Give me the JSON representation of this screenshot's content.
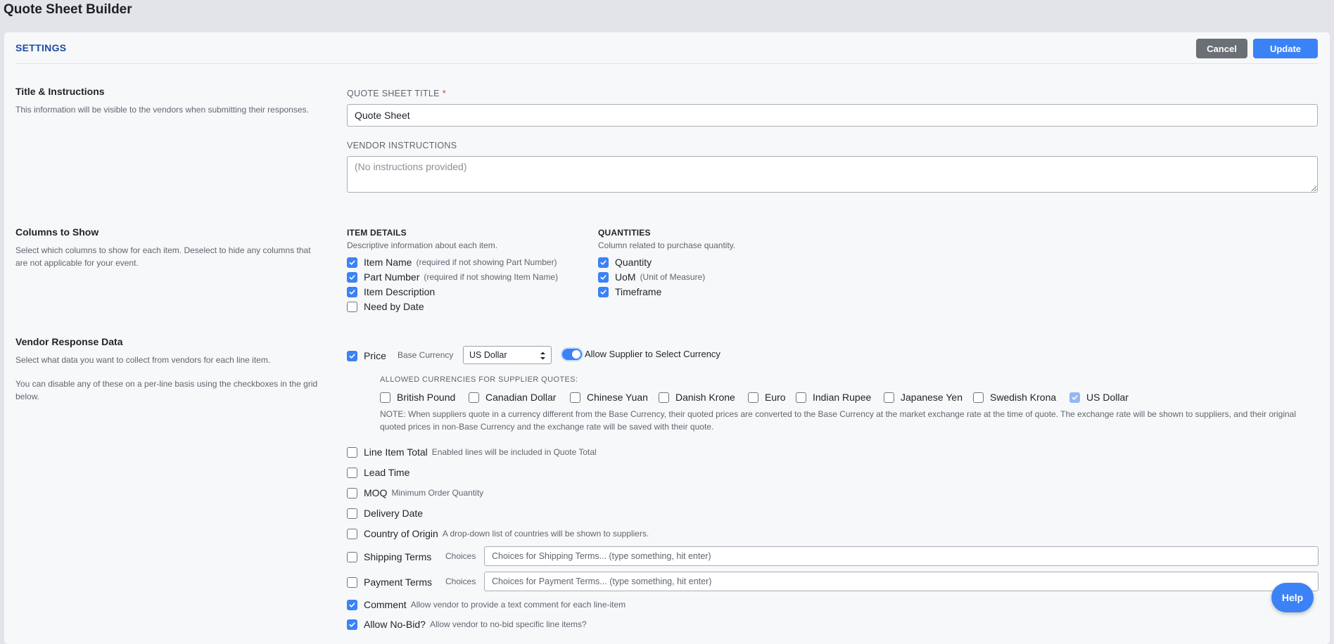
{
  "app": {
    "title": "Quote Sheet Builder"
  },
  "settings": {
    "header": "SETTINGS",
    "cancel_label": "Cancel",
    "update_label": "Update"
  },
  "title_instructions": {
    "title": "Title & Instructions",
    "desc": "This information will be visible to the vendors when submitting their responses.",
    "quote_title_label": "QUOTE SHEET TITLE",
    "required_mark": "*",
    "quote_title_value": "Quote Sheet",
    "vendor_instructions_label": "VENDOR INSTRUCTIONS",
    "vendor_instructions_placeholder": "(No instructions provided)"
  },
  "columns": {
    "title": "Columns to Show",
    "desc": "Select which columns to show for each item. Deselect to hide any columns that are not applicable for your event.",
    "item_details": {
      "title": "ITEM DETAILS",
      "desc": "Descriptive information about each item.",
      "items": [
        {
          "label": "Item Name",
          "hint": "(required if not showing Part Number)",
          "checked": true
        },
        {
          "label": "Part Number",
          "hint": "(required if not showing Item Name)",
          "checked": true
        },
        {
          "label": "Item Description",
          "hint": "",
          "checked": true
        },
        {
          "label": "Need by Date",
          "hint": "",
          "checked": false
        }
      ]
    },
    "quantities": {
      "title": "QUANTITIES",
      "desc": "Column related to purchase quantity.",
      "items": [
        {
          "label": "Quantity",
          "hint": "",
          "checked": true
        },
        {
          "label": "UoM",
          "hint": "(Unit of Measure)",
          "checked": true
        },
        {
          "label": "Timeframe",
          "hint": "",
          "checked": true
        }
      ]
    }
  },
  "vendor_response": {
    "title": "Vendor Response Data",
    "desc1": "Select what data you want to collect from vendors for each line item.",
    "desc2": "You can disable any of these on a per-line basis using the checkboxes in the grid below.",
    "price": {
      "label": "Price",
      "checked": true,
      "base_currency_label": "Base Currency",
      "base_currency_value": "US Dollar",
      "allow_select_label": "Allow Supplier to Select Currency",
      "allow_select_on": true
    },
    "allowed_currencies_title": "ALLOWED CURRENCIES FOR SUPPLIER QUOTES:",
    "currencies": [
      {
        "label": "British Pound",
        "checked": false
      },
      {
        "label": "Canadian Dollar",
        "checked": false
      },
      {
        "label": "Chinese Yuan",
        "checked": false
      },
      {
        "label": "Danish Krone",
        "checked": false
      },
      {
        "label": "Euro",
        "checked": false
      },
      {
        "label": "Indian Rupee",
        "checked": false
      },
      {
        "label": "Japanese Yen",
        "checked": false
      },
      {
        "label": "Swedish Krona",
        "checked": false
      },
      {
        "label": "US Dollar",
        "checked": true
      }
    ],
    "note": "NOTE: When suppliers quote in a currency different from the Base Currency, their quoted prices are converted to the Base Currency at the market exchange rate at the time of quote. The exchange rate will be shown to suppliers, and their original quoted prices in non-Base Currency and the exchange rate will be saved with their quote.",
    "options": [
      {
        "label": "Line Item Total",
        "hint": "Enabled lines will be included in Quote Total",
        "checked": false
      },
      {
        "label": "Lead Time",
        "hint": "",
        "checked": false
      },
      {
        "label": "MOQ",
        "hint": "Minimum Order Quantity",
        "checked": false
      },
      {
        "label": "Delivery Date",
        "hint": "",
        "checked": false
      },
      {
        "label": "Country of Origin",
        "hint": "A drop-down list of countries will be shown to suppliers.",
        "checked": false
      }
    ],
    "shipping": {
      "label": "Shipping Terms",
      "checked": false,
      "choices_label": "Choices",
      "placeholder": "Choices for Shipping Terms... (type something, hit enter)"
    },
    "payment": {
      "label": "Payment Terms",
      "checked": false,
      "choices_label": "Choices",
      "placeholder": "Choices for Payment Terms... (type something, hit enter)"
    },
    "comment": {
      "label": "Comment",
      "hint": "Allow vendor to provide a text comment for each line-item",
      "checked": true
    },
    "no_bid": {
      "label": "Allow No-Bid?",
      "hint": "Allow vendor to no-bid specific line items?",
      "checked": true
    }
  },
  "help": {
    "label": "Help"
  },
  "colors": {
    "accent": "#3b82f6",
    "heading_blue": "#1b4ea3",
    "cancel_gray": "#6b6f76"
  }
}
